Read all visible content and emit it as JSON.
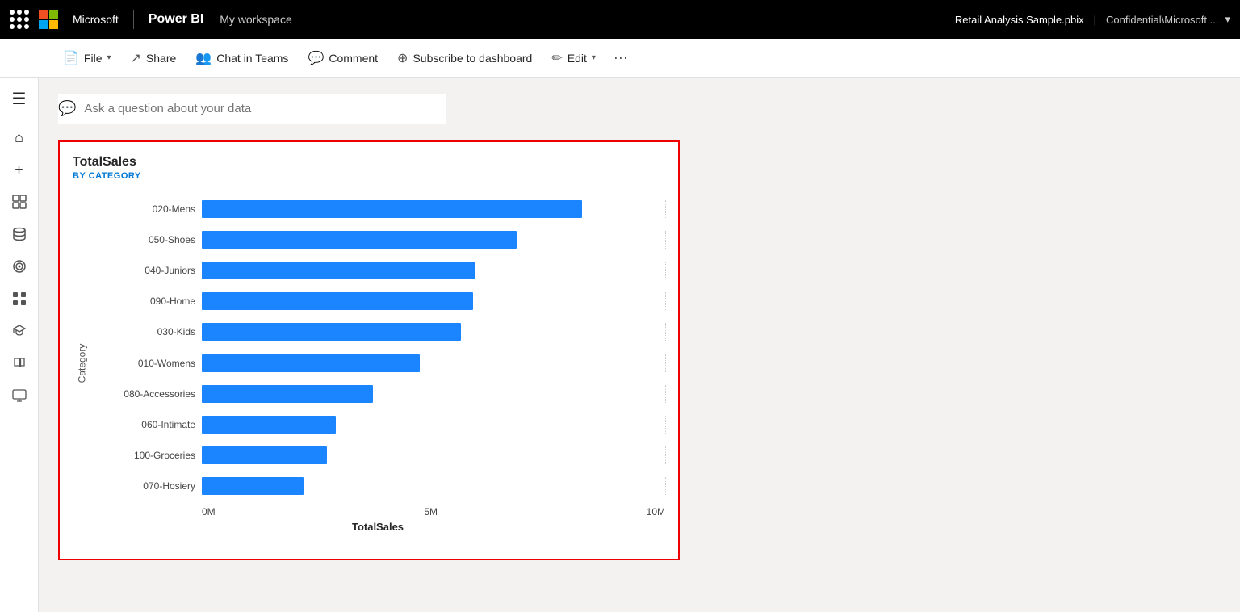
{
  "topbar": {
    "app_title": "Microsoft",
    "product": "Power BI",
    "workspace": "My workspace",
    "filename": "Retail Analysis Sample.pbix",
    "confidential": "Confidential\\Microsoft ...",
    "chevron": "▾"
  },
  "toolbar": {
    "file_label": "File",
    "share_label": "Share",
    "chat_label": "Chat in Teams",
    "comment_label": "Comment",
    "subscribe_label": "Subscribe to dashboard",
    "edit_label": "Edit",
    "more_label": "···"
  },
  "sidebar": {
    "hamburger": "☰",
    "items": [
      {
        "name": "home",
        "icon": "⌂"
      },
      {
        "name": "create",
        "icon": "+"
      },
      {
        "name": "browse",
        "icon": "🗂"
      },
      {
        "name": "data",
        "icon": "🗄"
      },
      {
        "name": "goals",
        "icon": "🏆"
      },
      {
        "name": "apps",
        "icon": "⊞"
      },
      {
        "name": "learn",
        "icon": "🚀"
      },
      {
        "name": "read",
        "icon": "📖"
      },
      {
        "name": "monitor",
        "icon": "🖥"
      }
    ]
  },
  "qa": {
    "placeholder": "Ask a question about your data",
    "icon": "💬"
  },
  "chart": {
    "title": "TotalSales",
    "subtitle": "BY CATEGORY",
    "y_axis_label": "Category",
    "x_axis_label": "TotalSales",
    "x_ticks": [
      "0M",
      "5M",
      "10M"
    ],
    "max_value": 10000000,
    "bars": [
      {
        "label": "020-Mens",
        "value": 8200000
      },
      {
        "label": "050-Shoes",
        "value": 6800000
      },
      {
        "label": "040-Juniors",
        "value": 5900000
      },
      {
        "label": "090-Home",
        "value": 5850000
      },
      {
        "label": "030-Kids",
        "value": 5600000
      },
      {
        "label": "010-Womens",
        "value": 4700000
      },
      {
        "label": "080-Accessories",
        "value": 3700000
      },
      {
        "label": "060-Intimate",
        "value": 2900000
      },
      {
        "label": "100-Groceries",
        "value": 2700000
      },
      {
        "label": "070-Hosiery",
        "value": 2200000
      }
    ]
  }
}
